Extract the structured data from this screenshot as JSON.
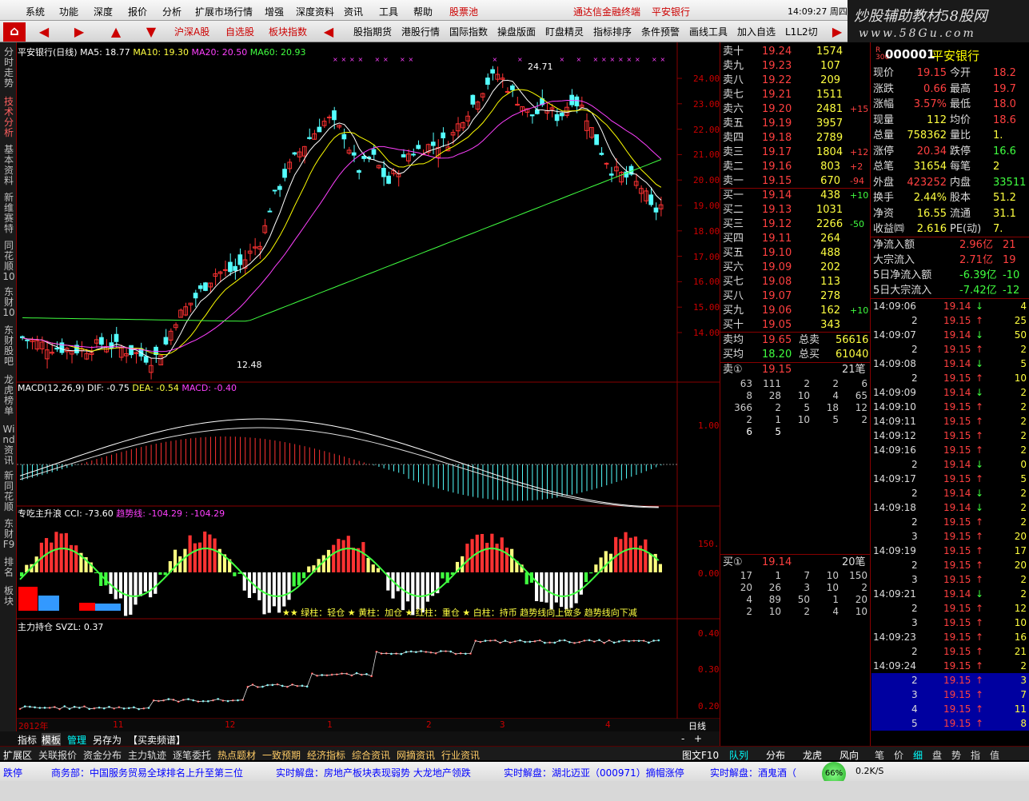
{
  "menu": {
    "items": [
      "系统",
      "功能",
      "深度",
      "报价",
      "分析",
      "扩展市场行情",
      "增强",
      "深度资料",
      "资讯",
      "工具",
      "帮助"
    ],
    "stock_pool": "股票池",
    "broker": "通达信金融终端",
    "stock": "平安银行",
    "time": "14:09:27 周四"
  },
  "toolbar": {
    "items": [
      "沪深A股",
      "自选股",
      "板块指数",
      "股指期货",
      "港股行情",
      "国际指数",
      "操盘版面",
      "盯盘精灵",
      "指标排序",
      "条件预警",
      "画线工具",
      "加入自选",
      "L1L2切"
    ]
  },
  "logo": {
    "text": "炒股辅助教材58股网",
    "url": "www.58Gu.com"
  },
  "sidebar": {
    "items": [
      "分时走势",
      "技术分析",
      "基本资料",
      "新维赛特",
      "同花顺10",
      "东财10",
      "东财股吧",
      "龙虎榜单",
      "Wind资讯",
      "新同花顺",
      "东财F9",
      "排名",
      "板块"
    ]
  },
  "chart_panel": {
    "title": "平安银行(日线)",
    "ma5": "MA5: 18.77",
    "ma10": "MA10: 19.30",
    "ma20": "MA20: 20.50",
    "ma60": "MA60: 20.93",
    "high_label": "24.71",
    "low_label": "12.48",
    "price_ticks": [
      "24.00",
      "23.00",
      "22.00",
      "21.00",
      "20.00",
      "19.00",
      "18.00",
      "17.00",
      "16.00",
      "15.00",
      "14.00"
    ],
    "macd_title": "MACD(12,26,9)",
    "macd_dif": "DIF: -0.75",
    "macd_dea": "DEA: -0.54",
    "macd_val": "MACD: -0.40",
    "macd_tick": "1.00",
    "cci_title": "专吃主升浪",
    "cci_val": "CCI: -73.60",
    "cci_trend": "趋势线: -104.29 : -104.29",
    "cci_ticks": [
      "150.0",
      "0.00"
    ],
    "cci_legend": "★★ 绿柱：轻仓 ★ 黄柱：加仓 ★ 红柱：重仓 ★ 白柱：持币 趋势线向上做多 趋势线向下减",
    "svzl_title": "主力持仓",
    "svzl_val": "SVZL: 0.37",
    "svzl_ticks": [
      "0.40",
      "0.30",
      "0.20"
    ],
    "date_labels": [
      "2012年",
      "11",
      "12",
      "1",
      "2",
      "3",
      "4"
    ],
    "period": "日线",
    "tabs": [
      "指标",
      "模板",
      "管理",
      "另存为",
      "【买卖频谱】"
    ]
  },
  "chart_data": [
    {
      "type": "candlestick",
      "title": "平安银行(日线)",
      "ylim": [
        12,
        25
      ],
      "high": 24.71,
      "low": 12.48,
      "series": [
        {
          "name": "MA5",
          "last": 18.77
        },
        {
          "name": "MA10",
          "last": 19.3
        },
        {
          "name": "MA20",
          "last": 20.5
        },
        {
          "name": "MA60",
          "last": 20.93
        }
      ]
    },
    {
      "type": "bar",
      "title": "MACD(12,26,9)",
      "series": [
        {
          "name": "DIF",
          "last": -0.75
        },
        {
          "name": "DEA",
          "last": -0.54
        },
        {
          "name": "MACD",
          "last": -0.4
        }
      ]
    },
    {
      "type": "bar",
      "title": "专吃主升浪",
      "series": [
        {
          "name": "CCI",
          "last": -73.6
        },
        {
          "name": "趋势线",
          "last": -104.29
        }
      ]
    },
    {
      "type": "line",
      "title": "主力持仓",
      "ylim": [
        0.18,
        0.42
      ],
      "series": [
        {
          "name": "SVZL",
          "last": 0.37
        }
      ]
    }
  ],
  "order_book": {
    "sells": [
      [
        "卖十",
        "19.24",
        "1574",
        ""
      ],
      [
        "卖九",
        "19.23",
        "107",
        ""
      ],
      [
        "卖八",
        "19.22",
        "209",
        ""
      ],
      [
        "卖七",
        "19.21",
        "1511",
        ""
      ],
      [
        "卖六",
        "19.20",
        "2481",
        "+15"
      ],
      [
        "卖五",
        "19.19",
        "3957",
        ""
      ],
      [
        "卖四",
        "19.18",
        "2789",
        ""
      ],
      [
        "卖三",
        "19.17",
        "1804",
        "+12"
      ],
      [
        "卖二",
        "19.16",
        "803",
        "+2"
      ],
      [
        "卖一",
        "19.15",
        "670",
        "-94"
      ]
    ],
    "buys": [
      [
        "买一",
        "19.14",
        "438",
        "+10"
      ],
      [
        "买二",
        "19.13",
        "1031",
        ""
      ],
      [
        "买三",
        "19.12",
        "2266",
        "-50"
      ],
      [
        "买四",
        "19.11",
        "264",
        ""
      ],
      [
        "买五",
        "19.10",
        "488",
        ""
      ],
      [
        "买六",
        "19.09",
        "202",
        ""
      ],
      [
        "买七",
        "19.08",
        "113",
        ""
      ],
      [
        "买八",
        "19.07",
        "278",
        ""
      ],
      [
        "买九",
        "19.06",
        "162",
        "+10"
      ],
      [
        "买十",
        "19.05",
        "343",
        ""
      ]
    ],
    "sell_avg_label": "卖均",
    "sell_avg": "19.65",
    "sell_total_label": "总卖",
    "sell_total": "56616",
    "buy_avg_label": "买均",
    "buy_avg": "18.20",
    "buy_total_label": "总买",
    "buy_total": "61040",
    "sell1_label": "卖①",
    "sell1_price": "19.15",
    "sell1_count": "21笔",
    "sell1_queue": [
      [
        "63",
        "111",
        "2",
        "2",
        "6"
      ],
      [
        "8",
        "28",
        "10",
        "4",
        "65"
      ],
      [
        "366",
        "2",
        "5",
        "18",
        "12"
      ],
      [
        "2",
        "1",
        "10",
        "5",
        "2"
      ],
      [
        "6",
        "5",
        "",
        "",
        ""
      ]
    ],
    "buy1_label": "买①",
    "buy1_price": "19.14",
    "buy1_count": "20笔",
    "buy1_queue": [
      [
        "17",
        "1",
        "7",
        "10",
        "150"
      ],
      [
        "20",
        "26",
        "3",
        "10",
        "2"
      ],
      [
        "4",
        "89",
        "50",
        "1",
        "20"
      ],
      [
        "2",
        "10",
        "2",
        "4",
        "10"
      ]
    ]
  },
  "quote": {
    "code": "000001",
    "name": "平安银行",
    "rows": [
      [
        "现价",
        "19.15",
        "今开",
        "18.2"
      ],
      [
        "涨跌",
        "0.66",
        "最高",
        "19.7"
      ],
      [
        "涨幅",
        "3.57%",
        "最低",
        "18.0"
      ],
      [
        "现量",
        "112",
        "均价",
        "18.6"
      ],
      [
        "总量",
        "758362",
        "量比",
        "1."
      ],
      [
        "涨停",
        "20.34",
        "跌停",
        "16.6"
      ],
      [
        "总笔",
        "31654",
        "每笔",
        "2"
      ],
      [
        "外盘",
        "423252",
        "内盘",
        "33511"
      ],
      [
        "换手",
        "2.44%",
        "股本",
        "51.2"
      ],
      [
        "净资",
        "16.55",
        "流通",
        "31.1"
      ],
      [
        "收益㈣",
        "2.616",
        "PE(动)",
        "7."
      ]
    ],
    "flows": [
      [
        "净流入额",
        "2.96亿",
        "21"
      ],
      [
        "大宗流入",
        "2.71亿",
        "19"
      ],
      [
        "5日净流入额",
        "-6.39亿",
        "-10"
      ],
      [
        "5日大宗流入",
        "-7.42亿",
        "-12"
      ]
    ]
  },
  "ticks": [
    [
      "14:09:06",
      "19.14",
      "4"
    ],
    [
      "2",
      "19.15",
      "25"
    ],
    [
      "14:09:07",
      "19.14",
      "50"
    ],
    [
      "2",
      "19.15",
      "2"
    ],
    [
      "14:09:08",
      "19.14",
      "5"
    ],
    [
      "2",
      "19.15",
      "10"
    ],
    [
      "14:09:09",
      "19.14",
      "2"
    ],
    [
      "14:09:10",
      "19.15",
      "2"
    ],
    [
      "14:09:11",
      "19.15",
      "2"
    ],
    [
      "14:09:12",
      "19.15",
      "2"
    ],
    [
      "14:09:16",
      "19.15",
      "2"
    ],
    [
      "2",
      "19.14",
      "0"
    ],
    [
      "14:09:17",
      "19.15",
      "5"
    ],
    [
      "2",
      "19.14",
      "2"
    ],
    [
      "14:09:18",
      "19.14",
      "2"
    ],
    [
      "2",
      "19.15",
      "2"
    ],
    [
      "3",
      "19.15",
      "20"
    ],
    [
      "14:09:19",
      "19.15",
      "17"
    ],
    [
      "2",
      "19.15",
      "20"
    ],
    [
      "3",
      "19.15",
      "2"
    ],
    [
      "14:09:21",
      "19.14",
      "2"
    ],
    [
      "2",
      "19.15",
      "12"
    ],
    [
      "3",
      "19.15",
      "10"
    ],
    [
      "14:09:23",
      "19.15",
      "16"
    ],
    [
      "2",
      "19.15",
      "21"
    ],
    [
      "14:09:24",
      "19.15",
      "2"
    ],
    [
      "2",
      "19.15",
      "3"
    ],
    [
      "3",
      "19.15",
      "7"
    ],
    [
      "4",
      "19.15",
      "11"
    ],
    [
      "5",
      "19.15",
      "8"
    ],
    [
      "6",
      "19.15",
      "40"
    ]
  ],
  "right_tabs": [
    "队列",
    "分布",
    "龙虎",
    "风向"
  ],
  "right_tabs2": [
    "笔",
    "价",
    "细",
    "盘",
    "势",
    "指",
    "值"
  ],
  "bottom_tabs": [
    "扩展区",
    "关联报价",
    "资金分布",
    "主力轨迹",
    "逐笔委托",
    "热点题材",
    "一致预期",
    "经济指标",
    "综合资讯",
    "网摘资讯",
    "行业资讯"
  ],
  "chart_f10": "图文F10",
  "ticker": [
    "跌停",
    "商务部：中国服务贸易全球排名上升至第三位",
    "实时解盘：房地产板块表现弱势 大龙地产领跌",
    "实时解盘：湖北迈亚（000971）摘帽涨停",
    "实时解盘：酒鬼酒（"
  ],
  "status": {
    "pct": "66%",
    "speed": "0.2K/S"
  }
}
